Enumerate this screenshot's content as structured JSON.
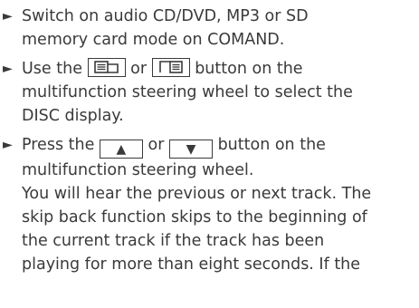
{
  "steps": [
    {
      "lines": [
        "Switch on audio CD/DVD, MP3 or SD",
        "memory card mode on COMAND."
      ]
    },
    {
      "line1_before": "Use the",
      "line1_between": "or",
      "line1_after": "button on the",
      "buttons": [
        "page-back-icon",
        "page-forward-icon"
      ],
      "lines": [
        "multifunction steering wheel to select the",
        "DISC display."
      ]
    },
    {
      "line1_before": "Press the",
      "line1_between": "or",
      "line1_after": "button on the",
      "buttons": [
        "up-triangle",
        "down-triangle"
      ],
      "glyph_up": "▲",
      "glyph_down": "▼",
      "lines": [
        "multifunction steering wheel.",
        "You will hear the previous or next track. The",
        "skip back function skips to the beginning of",
        "the current track if the track has been",
        "playing for more than eight seconds. If the"
      ]
    }
  ],
  "bullet_glyph": "►"
}
